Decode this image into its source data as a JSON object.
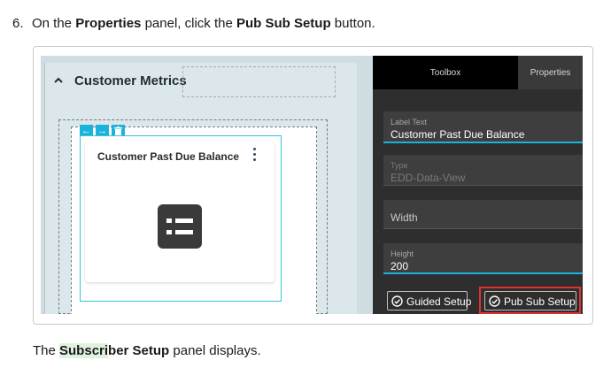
{
  "step": {
    "number": "6.",
    "text_before": "On the ",
    "panel_name": "Properties",
    "text_mid": " panel, click the ",
    "button_name": "Pub Sub Setup",
    "text_after": " button."
  },
  "canvas": {
    "section_title": "Customer Metrics",
    "widget_title": "Customer Past Due Balance",
    "toolbar_icons": [
      "arrow-left-icon",
      "arrow-right-icon",
      "trash-icon"
    ]
  },
  "panel": {
    "tabs": [
      "Toolbox",
      "Properties"
    ],
    "fields": {
      "label_text": {
        "label": "Label Text",
        "value": "Customer Past Due Balance"
      },
      "type": {
        "label": "Type",
        "value": "EDD-Data-View"
      },
      "width": {
        "placeholder": "Width"
      },
      "height": {
        "label": "Height",
        "value": "200"
      }
    },
    "buttons": {
      "guided": "Guided Setup",
      "pubsub": "Pub Sub Setup"
    }
  },
  "result": {
    "text_before": "The ",
    "highlight": "Subscri",
    "bold_rest": "ber Setup",
    "text_after": " panel displays."
  },
  "colors": {
    "accent": "#1ab3dc",
    "highlight_border": "#e0302f",
    "search_highlight": "#dff2dd"
  }
}
